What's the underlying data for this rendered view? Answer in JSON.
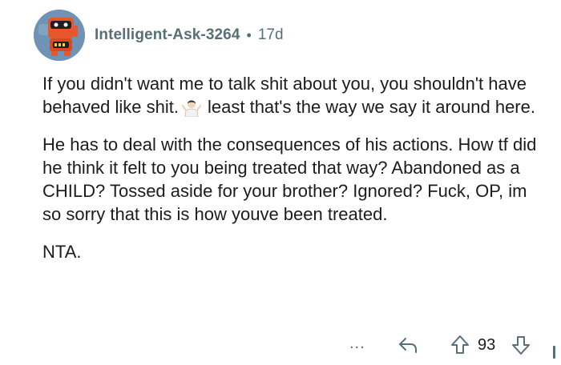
{
  "comment": {
    "author": "Intelligent-Ask-3264",
    "separator": "•",
    "age": "17d",
    "paragraphs": {
      "p1_before_emoji": "If you didn't want me to talk shit about you, you shouldn't have behaved like shit.",
      "p1_after_emoji": "least that's the way we say it around here.",
      "p2": "He has to deal with the consequences of his actions. How tf did he think it felt to you being treated that way? Abandoned as a CHILD? Tossed aside for your brother? Ignored? Fuck, OP, im so sorry that this is how youve been treated.",
      "p3": "NTA."
    },
    "emoji_icon": "person-shrugging-emoji-icon"
  },
  "actions": {
    "more_label": "...",
    "score": "93",
    "icons": [
      "reply-arrow-icon",
      "upvote-arrow-icon",
      "downvote-arrow-icon"
    ]
  },
  "colors": {
    "meta_text": "#576f76",
    "body_text": "#1c1c1c",
    "avatar_bg": "#6e93b4",
    "avatar_robot": "#e8572b"
  }
}
